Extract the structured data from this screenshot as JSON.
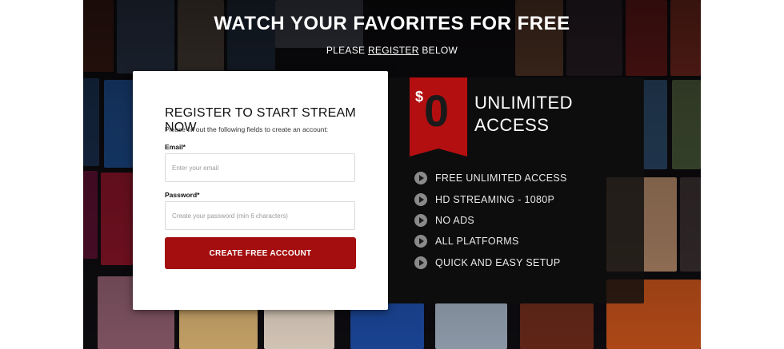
{
  "hero": {
    "headline": "WATCH YOUR FAVORITES FOR FREE",
    "sub_prefix": "PLEASE",
    "sub_link": "REGISTER",
    "sub_suffix": "BELOW"
  },
  "form": {
    "title": "REGISTER TO START STREAM NOW",
    "hint": "Please fill out the following fields to create an account:",
    "email_label": "Email*",
    "email_placeholder": "Enter your email",
    "password_label": "Password*",
    "password_placeholder": "Create your password (min 6 characters)",
    "submit_label": "CREATE FREE ACCOUNT"
  },
  "promo": {
    "price_currency": "$",
    "price_value": "0",
    "title_line1": "UNLIMITED",
    "title_line2": "ACCESS",
    "features": [
      "FREE UNLIMITED ACCESS",
      "HD STREAMING - 1080P",
      "NO ADS",
      "ALL PLATFORMS",
      "QUICK AND EASY SETUP"
    ]
  },
  "colors": {
    "accent_red": "#a40e0e",
    "ribbon_red": "#b30f10",
    "backdrop": "#0e0c10"
  }
}
